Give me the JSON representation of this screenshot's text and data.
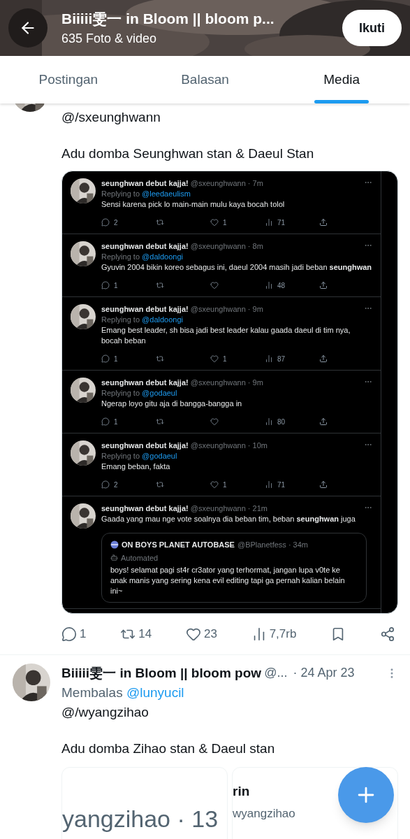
{
  "header": {
    "title": "Biiiii雯一 in Bloom || bloom p...",
    "subtitle": "635 Foto & video",
    "follow_button": "Ikuti"
  },
  "tabs": [
    {
      "label": "Postingan",
      "selected": false
    },
    {
      "label": "Balasan",
      "selected": false
    },
    {
      "label": "Media",
      "selected": true
    }
  ],
  "posts": [
    {
      "kind": "screenshot",
      "lines": [
        "@/sxeunghwann",
        "Adu domba Seunghwan stan & Daeul Stan"
      ],
      "screenshot": {
        "tweets": [
          {
            "name": "seunghwan debut kajja!",
            "meta": "@sxeunghwann · 7m",
            "replying_label": "Replying to",
            "replying_to": "@leedaeulism",
            "text": "Sensi karena pick lo main-main mulu kaya bocah tolol",
            "stats": {
              "replies": "2",
              "likes": "1",
              "views": "71"
            }
          },
          {
            "name": "seunghwan debut kajja!",
            "meta": "@sxeunghwann · 8m",
            "replying_label": "Replying to",
            "replying_to": "@daldoongi",
            "text": "Gyuvin 2004 bikin koreo sebagus ini, daeul 2004 masih jadi beban **seunghwan**",
            "stats": {
              "replies": "1",
              "views": "48"
            }
          },
          {
            "name": "seunghwan debut kajja!",
            "meta": "@sxeunghwann · 9m",
            "replying_label": "Replying to",
            "replying_to": "@daldoongi",
            "text": "Emang best leader, sh bisa jadi best leader kalau gaada daeul di tim nya, bocah beban",
            "stats": {
              "replies": "1",
              "likes": "1",
              "views": "87"
            }
          },
          {
            "name": "seunghwan debut kajja!",
            "meta": "@sxeunghwann · 9m",
            "replying_label": "Replying to",
            "replying_to": "@godaeul",
            "text": "Ngerap loyo gitu aja di bangga-bangga in",
            "stats": {
              "replies": "1",
              "views": "80"
            }
          },
          {
            "name": "seunghwan debut kajja!",
            "meta": "@sxeunghwann · 10m",
            "replying_label": "Replying to",
            "replying_to": "@godaeul",
            "text": "Emang beban, fakta",
            "stats": {
              "replies": "2",
              "likes": "1",
              "views": "71"
            }
          },
          {
            "name": "seunghwan debut kajja!",
            "meta": "@sxeunghwann · 21m",
            "text": "Gaada yang mau nge vote soalnya dia beban tim, beban **seunghwan** juga",
            "quote": {
              "name": "ON BOYS PLANET AUTOBASE",
              "meta": "@BPlanetfess · 34m",
              "label": "Automated",
              "text": "boys! selamat pagi st4r cr3ator yang terhormat, jangan lupa v0te ke anak manis yang sering kena evil editing tapi ga pernah kalian belain ini~"
            }
          }
        ]
      },
      "actions": {
        "replies": "1",
        "reposts": "14",
        "likes": "23",
        "views": "7,7rb"
      }
    },
    {
      "kind": "cards",
      "name": "Biiiii雯一 in Bloom || bloom pow",
      "handle": "@...",
      "date": "· 24 Apr 23",
      "reply_label": "Membalas",
      "reply_to": "@lunyucil",
      "lines": [
        "@/wyangzihao",
        "Adu domba Zihao stan & Daeul stan"
      ],
      "cards": [
        {
          "line_1": "yangzihao · 13"
        },
        {
          "line_1": "rin",
          "line_2": "wyangzihao"
        }
      ]
    }
  ]
}
